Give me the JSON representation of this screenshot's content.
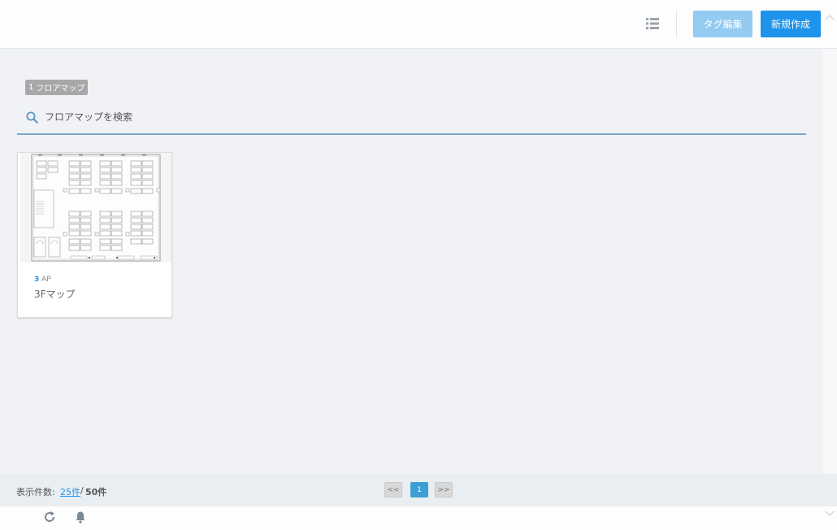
{
  "toolbar": {
    "list_view_icon": "list-icon",
    "tag_edit_label": "タグ編集",
    "new_label": "新規作成"
  },
  "list": {
    "count": "1",
    "count_label": "フロアマップ"
  },
  "search": {
    "placeholder": "フロアマップを検索",
    "icon": "search-icon"
  },
  "cards": [
    {
      "ap_count": "3",
      "ap_unit": "AP",
      "title": "3Fマップ"
    }
  ],
  "footer": {
    "per_page_label": "表示件数:",
    "per_page_value": "25件",
    "separator": "/",
    "per_page_total": "50件",
    "pager": {
      "prev": "<<",
      "current": "1",
      "next": ">>"
    }
  },
  "bottom": {
    "refresh_icon": "refresh-icon",
    "bell_icon": "bell-icon"
  },
  "colors": {
    "accent": "#1e93eb",
    "accent_light": "#93cbf1",
    "page_bg": "#f0f2f5"
  }
}
